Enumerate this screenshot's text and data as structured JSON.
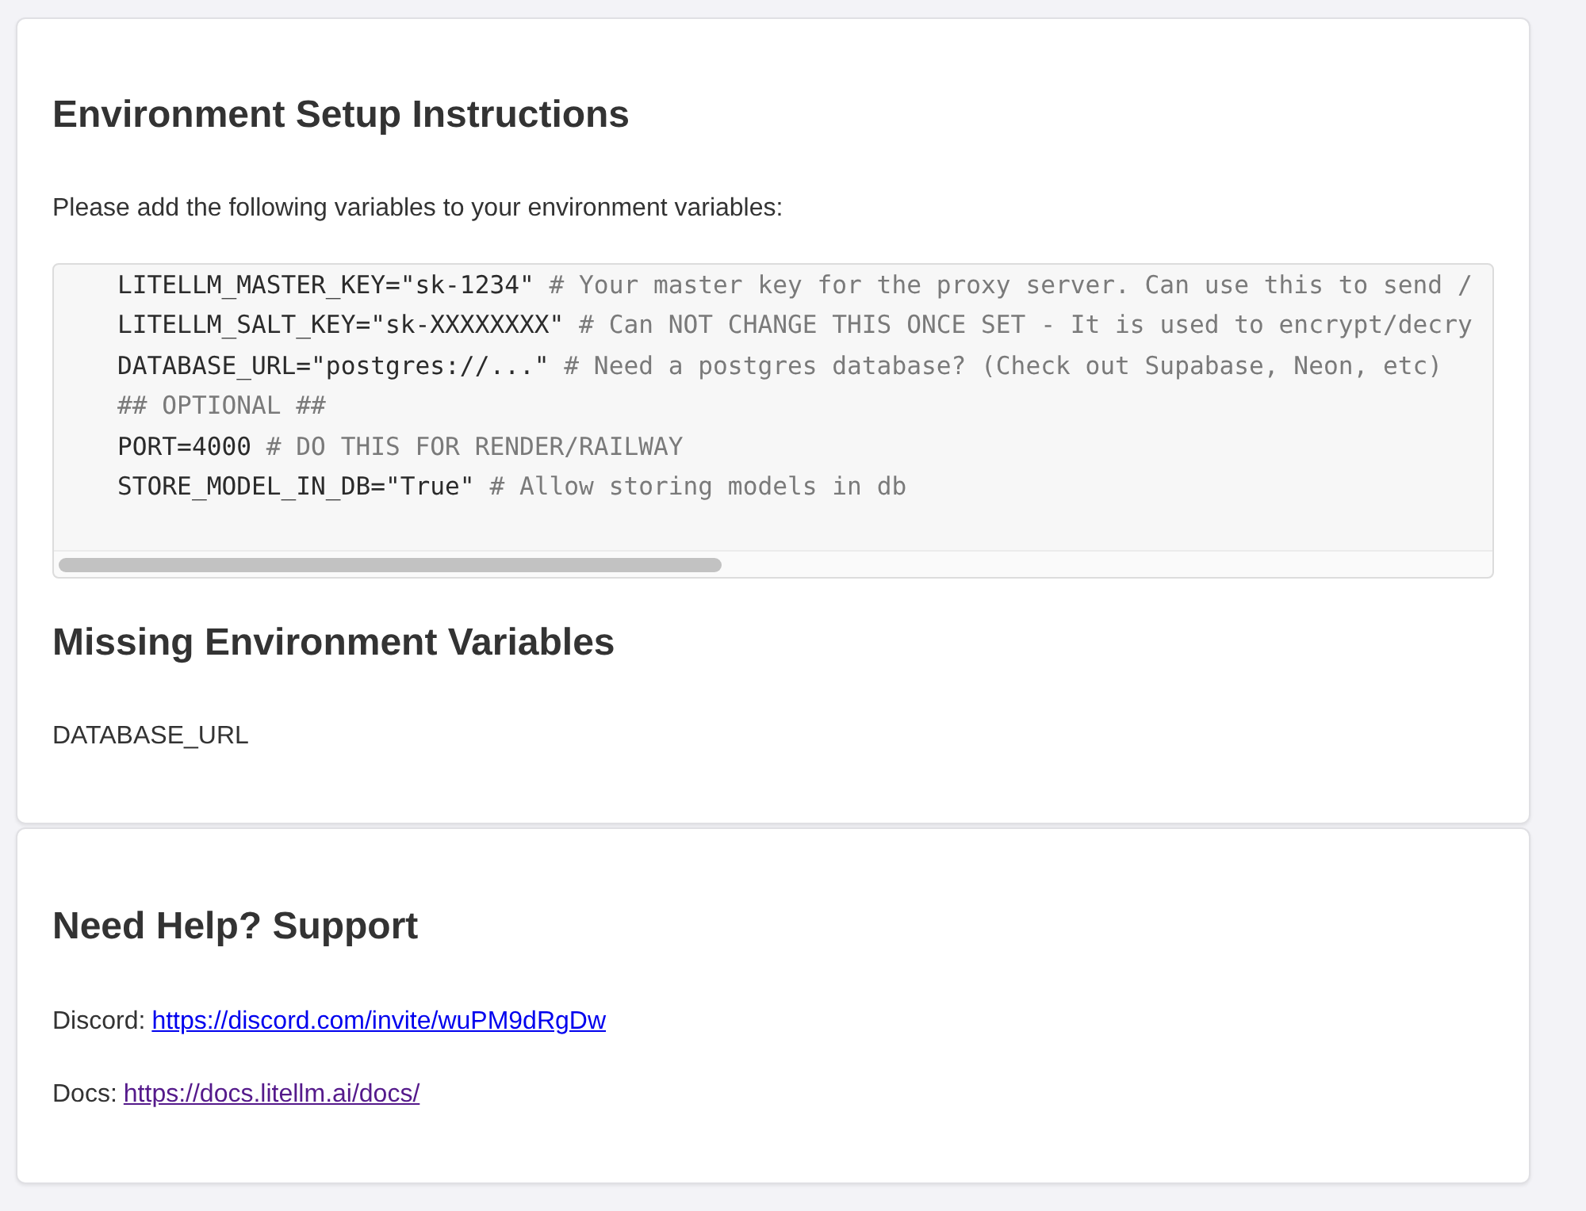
{
  "setup": {
    "title": "Environment Setup Instructions",
    "intro": "Please add the following variables to your environment variables:",
    "code_lines": [
      {
        "kind": "assignment",
        "code": "LITELLM_MASTER_KEY=\"sk-1234\"",
        "comment": "# Your master key for the proxy server. Can use this to send /"
      },
      {
        "kind": "assignment",
        "code": "LITELLM_SALT_KEY=\"sk-XXXXXXXX\"",
        "comment": "# Can NOT CHANGE THIS ONCE SET - It is used to encrypt/decry"
      },
      {
        "kind": "assignment",
        "code": "DATABASE_URL=\"postgres://...\"",
        "comment": "# Need a postgres database? (Check out Supabase, Neon, etc)"
      },
      {
        "kind": "comment",
        "comment": "## OPTIONAL ##"
      },
      {
        "kind": "assignment",
        "code": "PORT=4000",
        "comment": "# DO THIS FOR RENDER/RAILWAY"
      },
      {
        "kind": "assignment",
        "code": "STORE_MODEL_IN_DB=\"True\"",
        "comment": "# Allow storing models in db"
      }
    ]
  },
  "missing": {
    "title": "Missing Environment Variables",
    "variables": [
      "DATABASE_URL"
    ]
  },
  "support": {
    "title": "Need Help? Support",
    "links": [
      {
        "label": "Discord:",
        "url": "https://discord.com/invite/wuPM9dRgDw",
        "visited": false
      },
      {
        "label": "Docs:",
        "url": "https://docs.litellm.ai/docs/",
        "visited": true
      }
    ]
  }
}
